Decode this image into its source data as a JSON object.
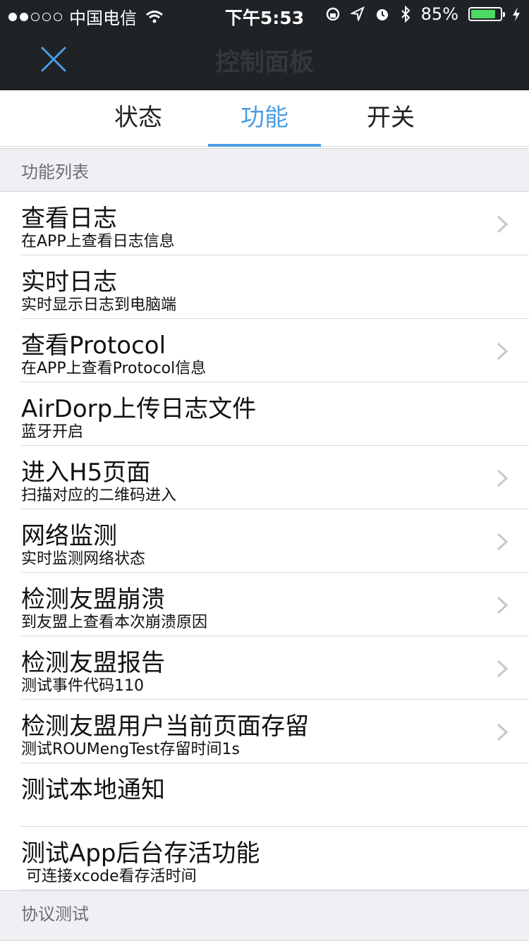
{
  "status_bar": {
    "carrier": "中国电信",
    "time": "下午5:53",
    "battery": "85%",
    "battery_level": 0.85
  },
  "nav": {
    "title": "控制面板"
  },
  "tabs": [
    {
      "label": "状态"
    },
    {
      "label": "功能"
    },
    {
      "label": "开关"
    }
  ],
  "sections": {
    "functions": "功能列表",
    "protocol": "协议测试"
  },
  "items": [
    {
      "title": "查看日志",
      "subtitle": "在APP上查看日志信息"
    },
    {
      "title": "实时日志",
      "subtitle": "实时显示日志到电脑端"
    },
    {
      "title": "查看Protocol",
      "subtitle": "在APP上查看Protocol信息"
    },
    {
      "title": "AirDorp上传日志文件",
      "subtitle": "蓝牙开启"
    },
    {
      "title": "进入H5页面",
      "subtitle": "扫描对应的二维码进入"
    },
    {
      "title": "网络监测",
      "subtitle": "实时监测网络状态"
    },
    {
      "title": "检测友盟崩溃",
      "subtitle": "到友盟上查看本次崩溃原因"
    },
    {
      "title": "检测友盟报告",
      "subtitle": "测试事件代码110"
    },
    {
      "title": "检测友盟用户当前页面存留",
      "subtitle": "测试ROUMengTest存留时间1s"
    },
    {
      "title": "测试本地通知",
      "subtitle": ""
    },
    {
      "title": "测试App后台存活功能",
      "subtitle": " 可连接xcode看存活时间"
    }
  ],
  "colors": {
    "accent": "#4a9de4",
    "nav_background": "#1f2326",
    "battery_green": "#4cd964"
  }
}
